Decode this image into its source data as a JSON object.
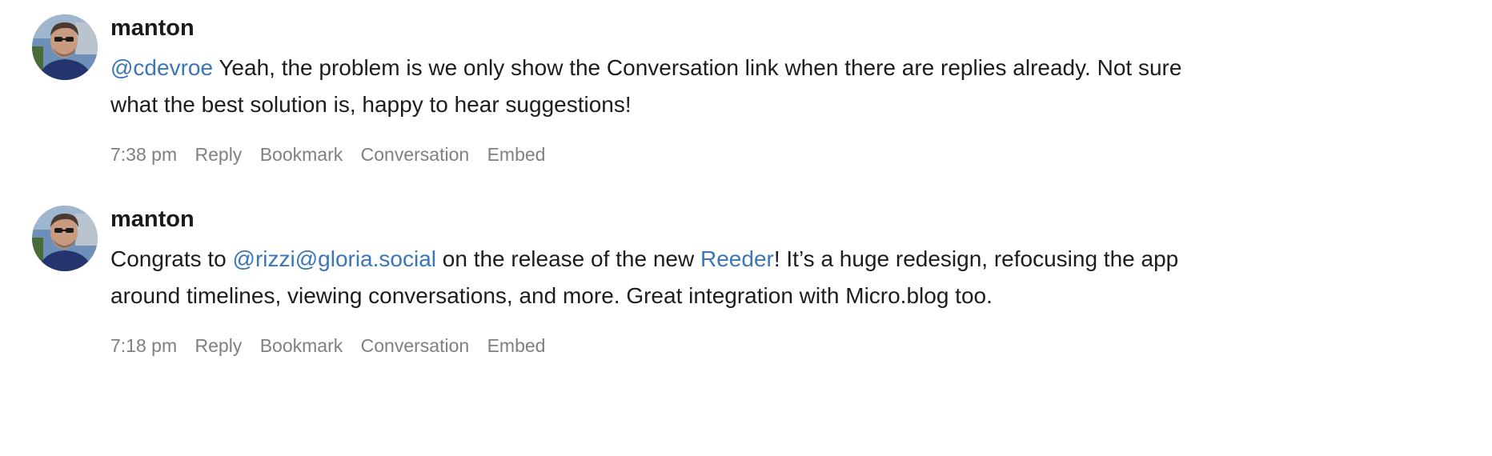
{
  "posts": [
    {
      "author": "manton",
      "text_parts": {
        "mention": "@cdevroe",
        "text": " Yeah, the problem is we only show the Conversation link when there are replies already. Not sure what the best solution is, happy to hear suggestions!"
      },
      "actions": {
        "time": "7:38 pm",
        "reply": "Reply",
        "bookmark": "Bookmark",
        "conversation": "Conversation",
        "embed": "Embed"
      }
    },
    {
      "author": "manton",
      "text_parts": {
        "pre": "Congrats to ",
        "mention": "@rizzi@gloria.social",
        "mid": " on the release of the new ",
        "link": "Reeder",
        "post": "! It’s a huge redesign, refocusing the app around timelines, viewing conversations, and more. Great integration with Micro.blog too."
      },
      "actions": {
        "time": "7:18 pm",
        "reply": "Reply",
        "bookmark": "Bookmark",
        "conversation": "Conversation",
        "embed": "Embed"
      }
    }
  ],
  "colors": {
    "link": "#3a76b8",
    "meta": "#808080",
    "text": "#1d1d1f"
  }
}
